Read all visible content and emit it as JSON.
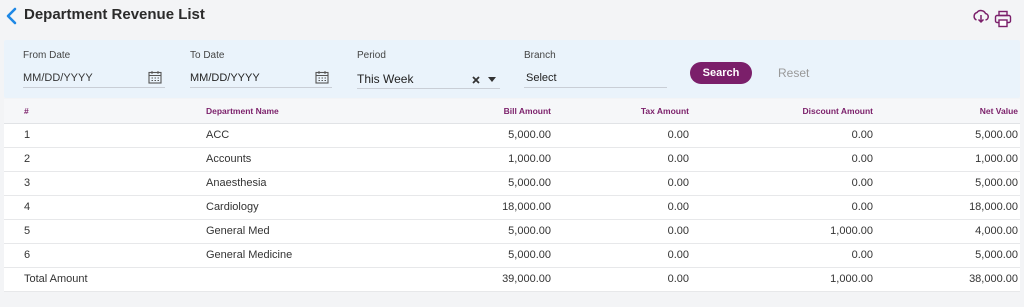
{
  "header": {
    "title": "Department Revenue List"
  },
  "filters": {
    "from_date": {
      "label": "From Date",
      "placeholder": "MM/DD/YYYY"
    },
    "to_date": {
      "label": "To Date",
      "placeholder": "MM/DD/YYYY"
    },
    "period": {
      "label": "Period",
      "value": "This Week"
    },
    "branch": {
      "label": "Branch",
      "placeholder": "Select"
    },
    "search_label": "Search",
    "reset_label": "Reset"
  },
  "table": {
    "headers": [
      "#",
      "Department Name",
      "Bill Amount",
      "Tax Amount",
      "Discount Amount",
      "Net Value"
    ],
    "rows": [
      [
        "1",
        "ACC",
        "5,000.00",
        "0.00",
        "0.00",
        "5,000.00"
      ],
      [
        "2",
        "Accounts",
        "1,000.00",
        "0.00",
        "0.00",
        "1,000.00"
      ],
      [
        "3",
        "Anaesthesia",
        "5,000.00",
        "0.00",
        "0.00",
        "5,000.00"
      ],
      [
        "4",
        "Cardiology",
        "18,000.00",
        "0.00",
        "0.00",
        "18,000.00"
      ],
      [
        "5",
        "General Med",
        "5,000.00",
        "0.00",
        "1,000.00",
        "4,000.00"
      ],
      [
        "6",
        "General Medicine",
        "5,000.00",
        "0.00",
        "0.00",
        "5,000.00"
      ]
    ],
    "total": [
      "Total Amount",
      "",
      "39,000.00",
      "0.00",
      "1,000.00",
      "38,000.00"
    ]
  },
  "colors": {
    "accent": "#7b1f6a",
    "back_arrow": "#1e88e5",
    "filter_bg": "#eaf3fb"
  },
  "icons": [
    "chevron-left-icon",
    "download-icon",
    "print-icon",
    "calendar-icon",
    "close-icon",
    "caret-down-icon"
  ]
}
